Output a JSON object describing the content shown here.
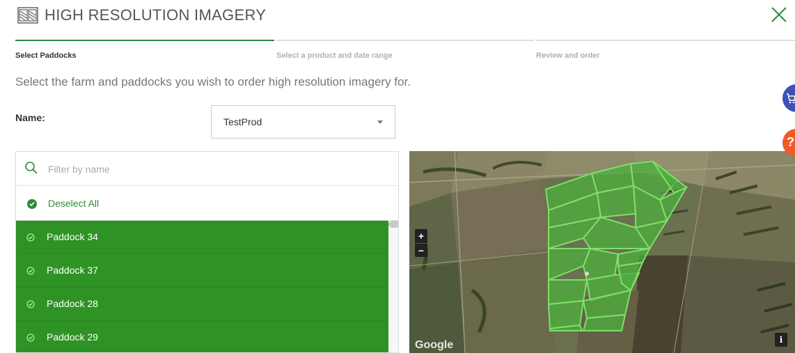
{
  "header": {
    "title": "HIGH RESOLUTION IMAGERY",
    "icon": "satellite-imagery-icon",
    "close_icon": "close-icon"
  },
  "steps": [
    {
      "label": "Select Paddocks",
      "active": true
    },
    {
      "label": "Select a product and date range",
      "active": false
    },
    {
      "label": "Review and order",
      "active": false
    }
  ],
  "instruction": "Select the farm and paddocks you wish to order high resolution imagery for.",
  "farm": {
    "label": "Name:",
    "selected": "TestProd"
  },
  "paddock_list": {
    "filter_placeholder": "Filter by name",
    "deselect_all": "Deselect All",
    "items": [
      {
        "label": "Paddock 34",
        "selected": true
      },
      {
        "label": "Paddock 37",
        "selected": true
      },
      {
        "label": "Paddock 28",
        "selected": true
      },
      {
        "label": "Paddock 29",
        "selected": true
      }
    ]
  },
  "map": {
    "zoom_in": "+",
    "zoom_out": "−",
    "info": "i",
    "attribution": "Google"
  },
  "side_buttons": [
    {
      "icon": "cart-icon",
      "color": "#3f51b5"
    },
    {
      "icon": "help-icon",
      "color": "#f05a28"
    }
  ],
  "colors": {
    "accent": "#2e8b3a",
    "selected_row": "#2e9224"
  }
}
